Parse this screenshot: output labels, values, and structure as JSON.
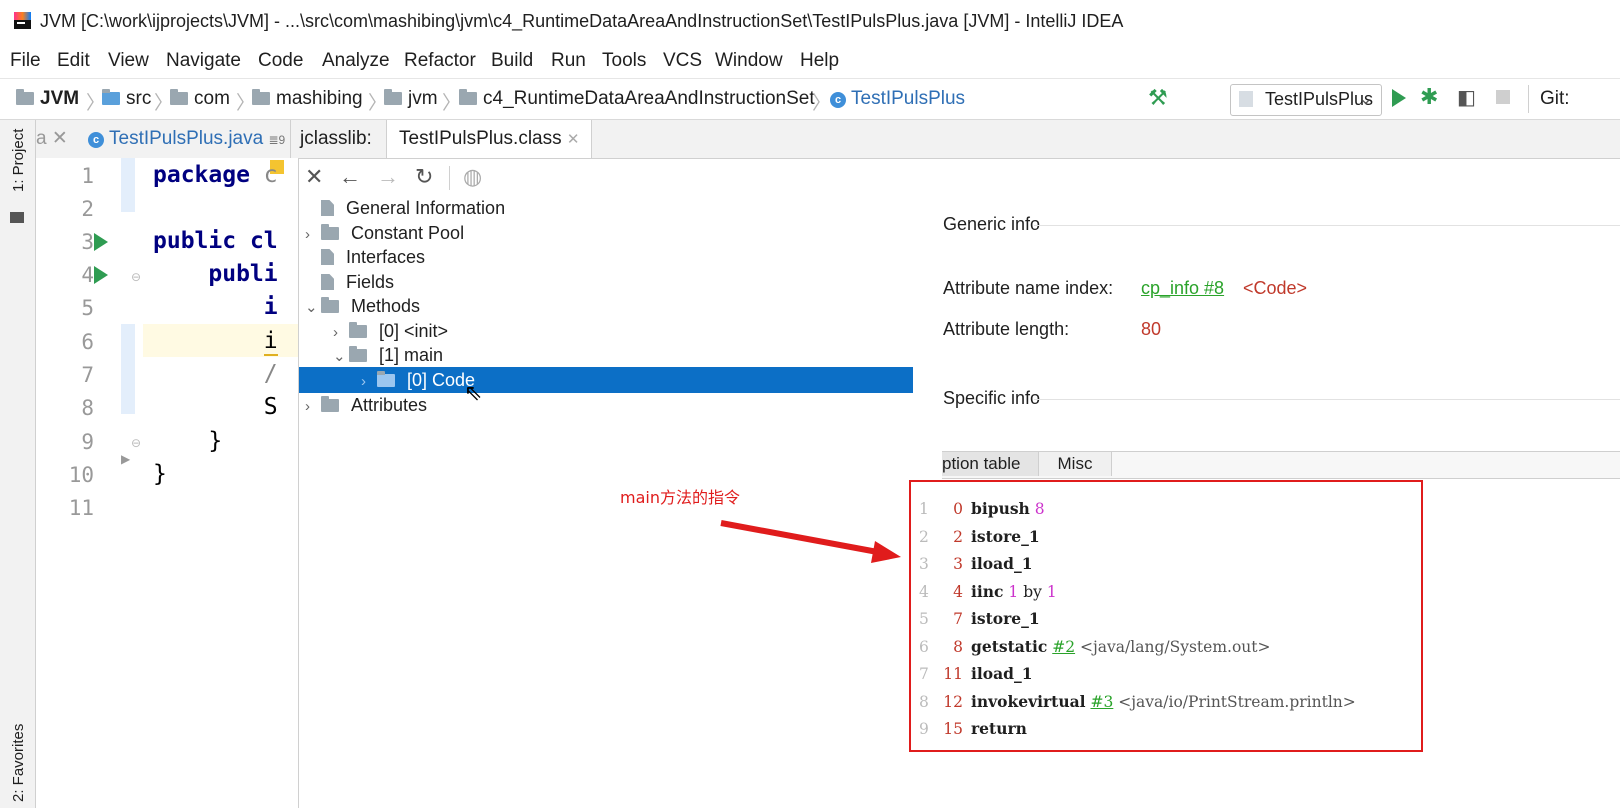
{
  "window": {
    "title": "JVM [C:\\work\\ijprojects\\JVM] - ...\\src\\com\\mashibing\\jvm\\c4_RuntimeDataAreaAndInstructionSet\\TestIPulsPlus.java [JVM] - IntelliJ IDEA"
  },
  "menu": [
    "File",
    "Edit",
    "View",
    "Navigate",
    "Code",
    "Analyze",
    "Refactor",
    "Build",
    "Run",
    "Tools",
    "VCS",
    "Window",
    "Help"
  ],
  "breadcrumb": {
    "project": "JVM",
    "items": [
      "src",
      "com",
      "mashibing",
      "jvm",
      "c4_RuntimeDataAreaAndInstructionSet"
    ],
    "class": "TestIPulsPlus",
    "run_config": "TestIPulsPlus",
    "git": "Git:"
  },
  "side": {
    "project": "1: Project",
    "favorites": "2: Favorites"
  },
  "tabs": {
    "closed_frag": "a",
    "java_tab": "TestIPulsPlus.java",
    "java_tab_badge": "9",
    "jclasslib": "jclasslib:",
    "class_tab": "TestIPulsPlus.class"
  },
  "editor": {
    "lines": [
      "1",
      "2",
      "3",
      "4",
      "5",
      "6",
      "7",
      "8",
      "9",
      "10",
      "11"
    ],
    "code": {
      "l1_kw": "package",
      "l1_rest": " c",
      "l3_kw": "public",
      "l3_rest": " cl",
      "l4_kw": "publi",
      "l5": "i",
      "l6": "i",
      "l7": "/",
      "l8": "S",
      "l9": "}",
      "l10": "}"
    }
  },
  "tree": {
    "general": "General Information",
    "constant_pool": "Constant Pool",
    "interfaces": "Interfaces",
    "fields": "Fields",
    "methods": "Methods",
    "init": "[0] <init>",
    "main": "[1] main",
    "code": "[0] Code",
    "attributes": "Attributes"
  },
  "info": {
    "generic": "Generic info",
    "attr_name_index_label": "Attribute name index:",
    "attr_name_index_link": "cp_info #8",
    "attr_name_index_value": "<Code>",
    "attr_length_label": "Attribute length:",
    "attr_length_value": "80",
    "specific": "Specific info",
    "subtab_exception": "ption table",
    "subtab_misc": "Misc"
  },
  "bytecode": [
    {
      "n": "1",
      "off": "0",
      "op": "bipush",
      "arg": "8"
    },
    {
      "n": "2",
      "off": "2",
      "op": "istore_1"
    },
    {
      "n": "3",
      "off": "3",
      "op": "iload_1"
    },
    {
      "n": "4",
      "off": "4",
      "op": "iinc",
      "arg": "1",
      "mid": "by",
      "arg2": "1"
    },
    {
      "n": "5",
      "off": "7",
      "op": "istore_1"
    },
    {
      "n": "6",
      "off": "8",
      "op": "getstatic",
      "ref": "#2",
      "cmt": "<java/lang/System.out>"
    },
    {
      "n": "7",
      "off": "11",
      "op": "iload_1"
    },
    {
      "n": "8",
      "off": "12",
      "op": "invokevirtual",
      "ref": "#3",
      "cmt": "<java/io/PrintStream.println>"
    },
    {
      "n": "9",
      "off": "15",
      "op": "return"
    }
  ],
  "annotation": "main方法的指令",
  "colors": {
    "selection": "#0c6fc6",
    "annotation": "#e01c1c",
    "run_green": "#2f9c52"
  }
}
